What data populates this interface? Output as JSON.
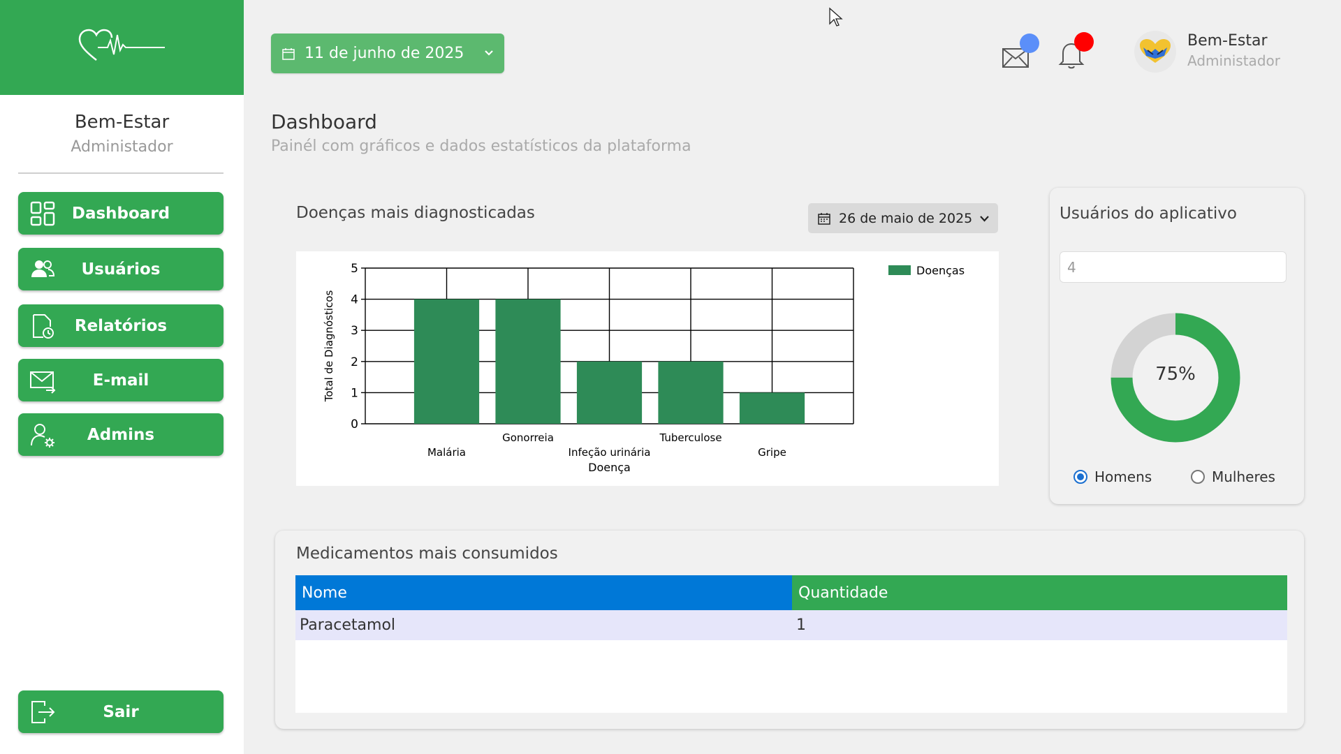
{
  "brand": {
    "name": "Bem-Estar",
    "role": "Administador"
  },
  "nav": [
    {
      "label": "Dashboard",
      "icon": "dashboard-grid-icon"
    },
    {
      "label": "Usuários",
      "icon": "users-icon"
    },
    {
      "label": "Relatórios",
      "icon": "report-icon"
    },
    {
      "label": "E-mail",
      "icon": "mail-send-icon"
    },
    {
      "label": "Admins",
      "icon": "admin-gear-icon"
    }
  ],
  "logout_label": "Sair",
  "header": {
    "date": "11 de junho de 2025",
    "user_name": "Bem-Estar",
    "user_role": "Administador"
  },
  "page": {
    "title": "Dashboard",
    "subtitle": "Painél com gráficos e dados estatísticos da plataforma"
  },
  "diseases_card": {
    "title": "Doenças mais diagnosticadas",
    "date": "26 de maio de 2025"
  },
  "chart_data": {
    "type": "bar",
    "categories": [
      "Malária",
      "Gonorreia",
      "Infeção urinária",
      "Tuberculose",
      "Gripe"
    ],
    "series": [
      {
        "name": "Doenças",
        "values": [
          4,
          4,
          2,
          2,
          1
        ]
      }
    ],
    "xlabel": "Doença",
    "ylabel": "Total de Diagnósticos",
    "ylim": [
      0,
      5
    ],
    "yticks": [
      0,
      1,
      2,
      3,
      4,
      5
    ],
    "grid": true,
    "legend": "top-right",
    "color": "#2e8b57"
  },
  "users_card": {
    "title": "Usuários do aplicativo",
    "count_value": "4",
    "percent_label": "75%",
    "percent": 75,
    "radio_men": "Homens",
    "radio_women": "Mulheres",
    "selected": "Homens"
  },
  "meds_card": {
    "title": "Medicamentos mais consumidos",
    "columns": [
      "Nome",
      "Quantidade"
    ],
    "rows": [
      [
        "Paracetamol",
        "1"
      ]
    ]
  },
  "colors": {
    "primary_green": "#33a853",
    "header_blue": "#0078d7",
    "notification_red": "#ff0000",
    "mail_badge_blue": "#5b8ff9"
  }
}
